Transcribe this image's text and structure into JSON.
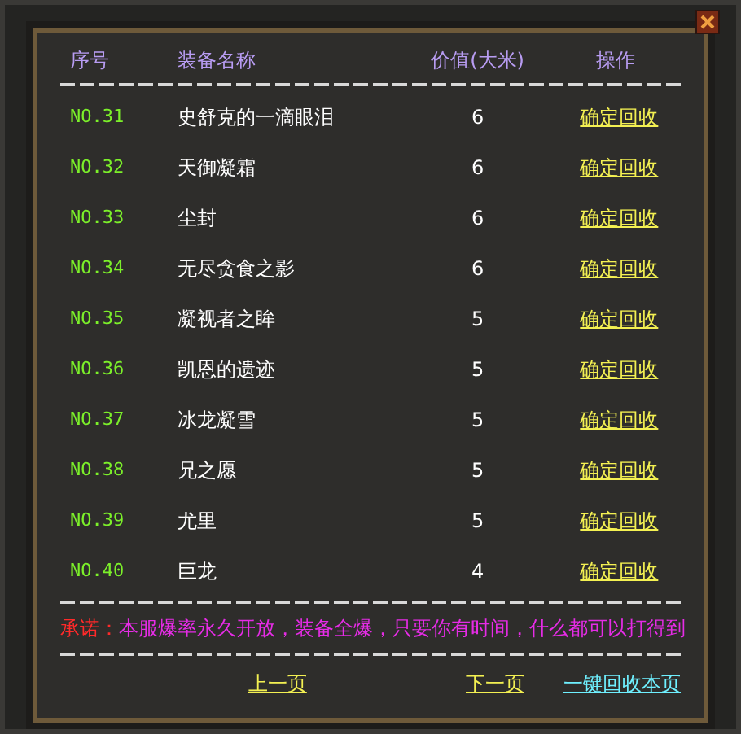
{
  "columns": [
    "序号",
    "装备名称",
    "价值(大米)",
    "操作"
  ],
  "rows": [
    {
      "number": "NO.31",
      "name": "史舒克的一滴眼泪",
      "value": "6",
      "action": "确定回收"
    },
    {
      "number": "NO.32",
      "name": "天御凝霜",
      "value": "6",
      "action": "确定回收"
    },
    {
      "number": "NO.33",
      "name": "尘封",
      "value": "6",
      "action": "确定回收"
    },
    {
      "number": "NO.34",
      "name": "无尽贪食之影",
      "value": "6",
      "action": "确定回收"
    },
    {
      "number": "NO.35",
      "name": "凝视者之眸",
      "value": "5",
      "action": "确定回收"
    },
    {
      "number": "NO.36",
      "name": "凯恩的遗迹",
      "value": "5",
      "action": "确定回收"
    },
    {
      "number": "NO.37",
      "name": "冰龙凝雪",
      "value": "5",
      "action": "确定回收"
    },
    {
      "number": "NO.38",
      "name": "兄之愿",
      "value": "5",
      "action": "确定回收"
    },
    {
      "number": "NO.39",
      "name": "尤里",
      "value": "5",
      "action": "确定回收"
    },
    {
      "number": "NO.40",
      "name": "巨龙",
      "value": "4",
      "action": "确定回收"
    }
  ],
  "notice": {
    "label": "承诺：",
    "text": "本服爆率永久开放，装备全爆，只要你有时间，什么都可以打得到"
  },
  "footer": {
    "prev": "上一页",
    "next": "下一页",
    "recycle_all": "一键回收本页"
  }
}
